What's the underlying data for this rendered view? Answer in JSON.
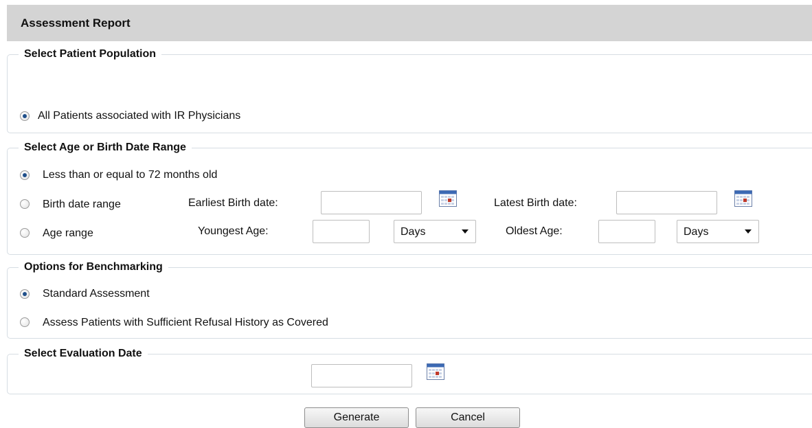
{
  "header": {
    "title": "Assessment Report"
  },
  "population": {
    "legend": "Select Patient Population",
    "option_all": "All Patients associated with IR Physicians"
  },
  "age": {
    "legend": "Select Age or Birth Date Range",
    "option_le72": "Less than or equal to 72 months old",
    "option_birth": "Birth date range",
    "option_age": "Age range",
    "earliest_label": "Earliest Birth date:",
    "latest_label": "Latest Birth date:",
    "youngest_label": "Youngest Age:",
    "oldest_label": "Oldest Age:",
    "youngest_unit": "Days",
    "oldest_unit": "Days"
  },
  "benchmark": {
    "legend": "Options for Benchmarking",
    "option_standard": "Standard Assessment",
    "option_refusal": "Assess Patients with Sufficient Refusal History as Covered"
  },
  "evaluation": {
    "legend": "Select Evaluation Date"
  },
  "actions": {
    "generate": "Generate",
    "cancel": "Cancel"
  }
}
